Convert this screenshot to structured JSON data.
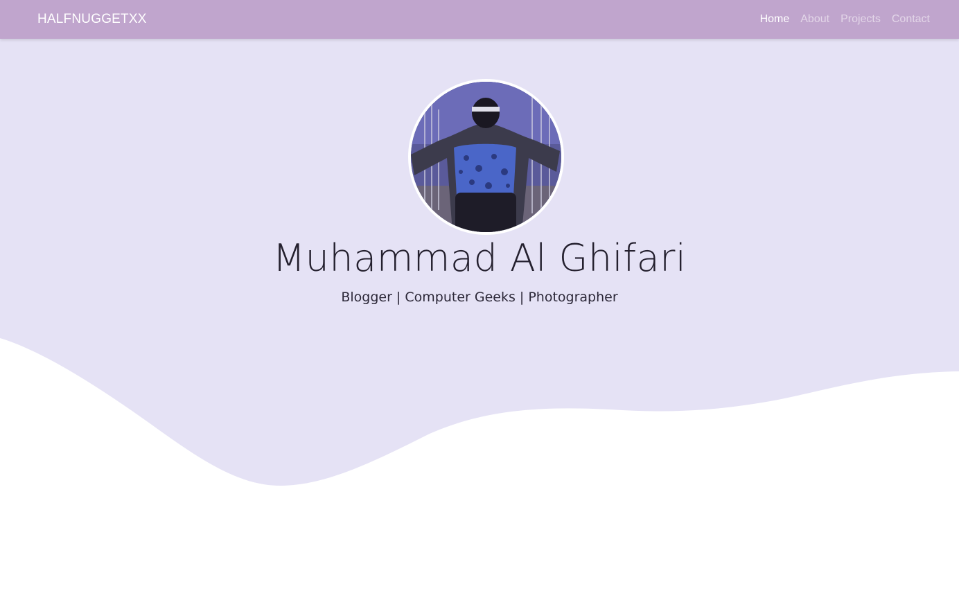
{
  "navbar": {
    "brand": "HALFNUGGETXX",
    "links": [
      {
        "label": "Home",
        "active": true
      },
      {
        "label": "About",
        "active": false
      },
      {
        "label": "Projects",
        "active": false
      },
      {
        "label": "Contact",
        "active": false
      }
    ]
  },
  "hero": {
    "name": "Muhammad Al Ghifari",
    "tagline": "Blogger | Computer Geeks | Photographer",
    "avatar_icon": "profile-photo"
  },
  "colors": {
    "navbar_bg": "#c0a5cd",
    "hero_bg": "#e5e2f5",
    "text_dark": "#24202e"
  }
}
